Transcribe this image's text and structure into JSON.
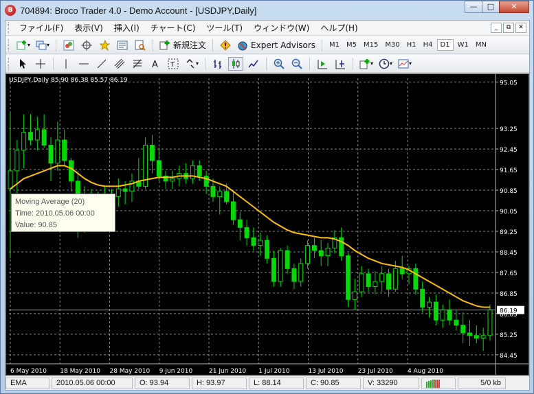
{
  "window": {
    "title": "704894: Broco Trader 4.0 - Demo Account - [USDJPY,Daily]",
    "app_icon": "broco-logo-icon",
    "controls": [
      "minimize-icon",
      "maximize-icon",
      "close-icon"
    ]
  },
  "menu": {
    "items": [
      "ファイル(F)",
      "表示(V)",
      "挿入(I)",
      "チャート(C)",
      "ツール(T)",
      "ウィンドウ(W)",
      "ヘルプ(H)"
    ]
  },
  "toolbar1": {
    "new_order_label": "新規注文",
    "expert_advisors_label": "Expert Advisors",
    "timeframes": [
      "M1",
      "M5",
      "M15",
      "M30",
      "H1",
      "H4",
      "D1",
      "W1",
      "MN"
    ],
    "active_timeframe": "D1"
  },
  "chart": {
    "info": "USDJPY,Daily  85.90 86.38 85.57 86.19",
    "current_price": "86.19",
    "colors": {
      "background": "#000000",
      "grid": "#8a8a8a",
      "bull": "#ffffff",
      "bear": "#00dd00",
      "ma": "#ffc000",
      "price_tag": "#ffffff"
    }
  },
  "tooltip": {
    "line1": "Moving Average (20)",
    "line2": "Time: 2010.05.06 00:00",
    "line3": "Value: 90.85"
  },
  "chart_data": {
    "type": "candlestick",
    "ylim": [
      84.1,
      95.2
    ],
    "yticks": [
      "95.05",
      "93.25",
      "92.45",
      "91.65",
      "90.85",
      "90.05",
      "89.25",
      "88.45",
      "87.65",
      "86.85",
      "86.05",
      "85.25",
      "84.45"
    ],
    "xticks": [
      "6 May 2010",
      "18 May 2010",
      "28 May 2010",
      "9 Jun 2010",
      "21 Jun 2010",
      "1 Jul 2010",
      "13 Jul 2010",
      "23 Jul 2010",
      "4 Aug 2010"
    ],
    "grid": true,
    "ohlc": [
      [
        90.9,
        93.9,
        88.2,
        91.6
      ],
      [
        91.6,
        92.8,
        90.6,
        92.4
      ],
      [
        92.4,
        93.8,
        91.7,
        93.1
      ],
      [
        93.1,
        93.8,
        92.6,
        92.8
      ],
      [
        92.8,
        93.7,
        92.4,
        93.2
      ],
      [
        93.2,
        93.8,
        92.5,
        92.6
      ],
      [
        92.6,
        92.9,
        91.2,
        91.9
      ],
      [
        91.9,
        93.5,
        91.6,
        92.8
      ],
      [
        92.8,
        93.2,
        91.8,
        92.0
      ],
      [
        92.0,
        92.1,
        90.8,
        91.2
      ],
      [
        91.2,
        91.6,
        89.0,
        89.8
      ],
      [
        89.8,
        91.0,
        89.2,
        90.5
      ],
      [
        90.5,
        90.9,
        89.3,
        89.7
      ],
      [
        89.7,
        90.8,
        89.4,
        90.4
      ],
      [
        90.4,
        91.0,
        89.6,
        90.0
      ],
      [
        90.0,
        90.9,
        89.5,
        90.6
      ],
      [
        90.6,
        91.3,
        90.2,
        90.9
      ],
      [
        90.9,
        91.2,
        90.3,
        90.8
      ],
      [
        90.8,
        91.5,
        90.4,
        91.2
      ],
      [
        91.2,
        92.1,
        90.9,
        91.0
      ],
      [
        91.0,
        92.9,
        90.9,
        92.6
      ],
      [
        92.6,
        93.0,
        91.5,
        92.0
      ],
      [
        92.0,
        92.5,
        91.2,
        91.4
      ],
      [
        91.4,
        91.6,
        90.9,
        91.2
      ],
      [
        91.2,
        91.6,
        90.9,
        91.3
      ],
      [
        91.3,
        91.8,
        91.0,
        91.5
      ],
      [
        91.5,
        91.9,
        91.1,
        91.3
      ],
      [
        91.3,
        92.0,
        91.1,
        91.8
      ],
      [
        91.8,
        92.0,
        91.2,
        91.4
      ],
      [
        91.4,
        91.6,
        90.7,
        91.0
      ],
      [
        91.0,
        91.3,
        90.4,
        90.6
      ],
      [
        90.6,
        91.0,
        89.9,
        90.8
      ],
      [
        90.8,
        91.1,
        90.3,
        90.4
      ],
      [
        90.4,
        90.8,
        89.5,
        89.7
      ],
      [
        89.7,
        90.0,
        88.9,
        89.4
      ],
      [
        89.4,
        89.7,
        88.7,
        89.0
      ],
      [
        89.0,
        89.4,
        88.5,
        88.7
      ],
      [
        88.7,
        89.2,
        88.3,
        88.9
      ],
      [
        88.9,
        89.1,
        88.0,
        88.2
      ],
      [
        88.2,
        88.5,
        87.1,
        87.3
      ],
      [
        87.3,
        88.6,
        87.1,
        88.5
      ],
      [
        88.5,
        88.7,
        87.6,
        87.8
      ],
      [
        87.8,
        88.0,
        87.0,
        87.3
      ],
      [
        87.3,
        88.2,
        87.1,
        88.0
      ],
      [
        88.0,
        88.9,
        87.8,
        88.7
      ],
      [
        88.7,
        89.0,
        88.2,
        88.5
      ],
      [
        88.5,
        88.9,
        87.9,
        88.3
      ],
      [
        88.3,
        88.8,
        87.9,
        88.6
      ],
      [
        88.6,
        89.3,
        88.4,
        89.0
      ],
      [
        89.0,
        89.4,
        88.1,
        88.3
      ],
      [
        88.3,
        88.4,
        86.3,
        86.6
      ],
      [
        86.6,
        87.4,
        86.2,
        86.9
      ],
      [
        86.9,
        87.9,
        86.7,
        87.6
      ],
      [
        87.6,
        87.8,
        86.9,
        87.1
      ],
      [
        87.1,
        87.7,
        86.8,
        87.3
      ],
      [
        87.3,
        87.9,
        86.9,
        87.6
      ],
      [
        87.6,
        87.8,
        86.7,
        87.0
      ],
      [
        87.0,
        88.1,
        86.9,
        87.8
      ],
      [
        87.8,
        88.3,
        87.4,
        87.6
      ],
      [
        87.6,
        87.9,
        87.2,
        87.8
      ],
      [
        87.8,
        88.0,
        86.8,
        87.0
      ],
      [
        87.0,
        87.3,
        86.1,
        86.3
      ],
      [
        86.3,
        86.7,
        85.9,
        86.5
      ],
      [
        86.5,
        86.8,
        85.6,
        85.8
      ],
      [
        85.8,
        86.4,
        85.5,
        86.2
      ],
      [
        86.2,
        86.6,
        85.6,
        85.8
      ],
      [
        85.8,
        86.2,
        85.4,
        85.6
      ],
      [
        85.6,
        86.1,
        84.9,
        85.3
      ],
      [
        85.3,
        85.8,
        84.8,
        85.2
      ],
      [
        85.2,
        85.6,
        84.9,
        85.1
      ],
      [
        85.1,
        85.5,
        84.6,
        85.2
      ],
      [
        85.2,
        86.4,
        85.0,
        86.2
      ]
    ],
    "ma": [
      90.9,
      91.1,
      91.3,
      91.4,
      91.5,
      91.6,
      91.7,
      91.8,
      91.8,
      91.7,
      91.5,
      91.3,
      91.15,
      91.05,
      91.0,
      91.0,
      91.0,
      91.05,
      91.1,
      91.2,
      91.25,
      91.3,
      91.35,
      91.35,
      91.35,
      91.4,
      91.4,
      91.4,
      91.35,
      91.3,
      91.2,
      91.1,
      91.0,
      90.8,
      90.6,
      90.4,
      90.2,
      90.0,
      89.8,
      89.6,
      89.45,
      89.3,
      89.2,
      89.15,
      89.1,
      89.05,
      89.0,
      89.0,
      88.95,
      88.85,
      88.7,
      88.5,
      88.35,
      88.2,
      88.1,
      88.0,
      87.95,
      87.9,
      87.85,
      87.75,
      87.6,
      87.45,
      87.3,
      87.15,
      87.0,
      86.85,
      86.7,
      86.55,
      86.45,
      86.35,
      86.3,
      86.3
    ],
    "ma_name": "Moving Average (20)"
  },
  "status": {
    "indicator": "EMA",
    "time": "2010.05.06 00:00",
    "open": "O: 93.94",
    "high": "H: 93.97",
    "low": "L: 88.14",
    "close": "C: 90.85",
    "volume": "V: 33290",
    "traffic": "5/0 kb",
    "connection_icon": "connection-bars-icon"
  }
}
